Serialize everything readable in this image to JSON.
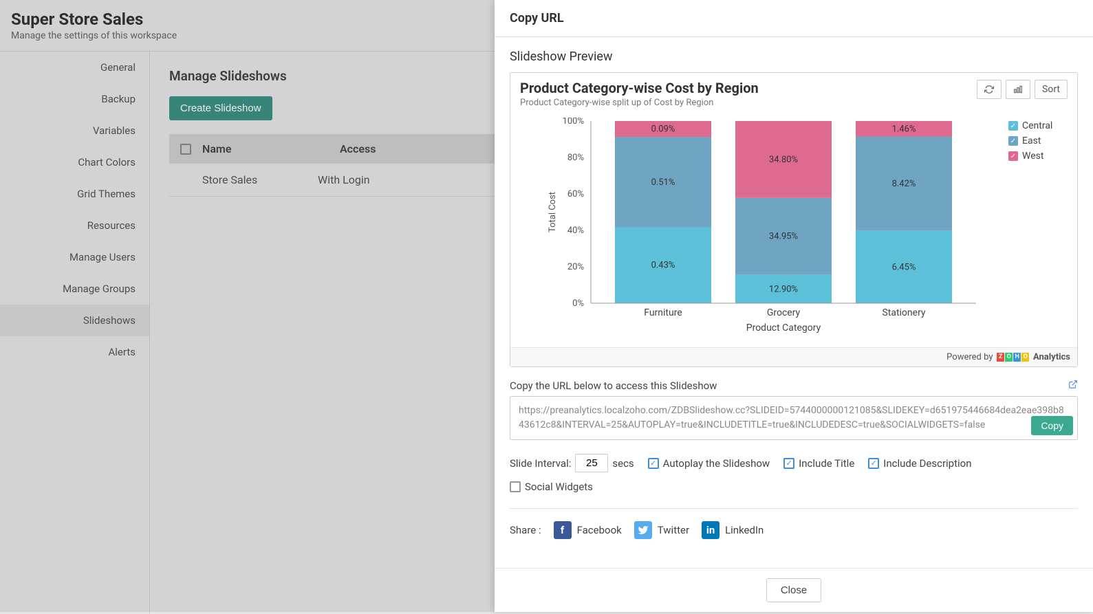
{
  "header": {
    "title": "Super Store Sales",
    "subtitle": "Manage the settings of this workspace"
  },
  "sidebar": {
    "items": [
      "General",
      "Backup",
      "Variables",
      "Chart Colors",
      "Grid Themes",
      "Resources",
      "Manage Users",
      "Manage Groups",
      "Slideshows",
      "Alerts"
    ],
    "active_index": 8
  },
  "content": {
    "title": "Manage Slideshows",
    "create_btn": "Create Slideshow",
    "columns": {
      "name": "Name",
      "access": "Access"
    },
    "rows": [
      {
        "name": "Store Sales",
        "access": "With Login"
      }
    ]
  },
  "modal": {
    "title": "Copy URL",
    "preview_label": "Slideshow Preview",
    "chart": {
      "title": "Product Category-wise Cost by Region",
      "subtitle": "Product Category-wise split up of Cost by Region",
      "sort_btn": "Sort",
      "powered_by": "Powered by",
      "analytics": "Analytics"
    },
    "url_label": "Copy the URL below to access this Slideshow",
    "url_value": "https://preanalytics.localzoho.com/ZDBSlideshow.cc?SLIDEID=5744000000121085&SLIDEKEY=d651975446684dea2eae398b843612c8&INTERVAL=25&AUTOPLAY=true&INCLUDETITLE=true&INCLUDEDESC=true&SOCIALWIDGETS=false",
    "copy_btn": "Copy",
    "options": {
      "interval_label": "Slide Interval:",
      "interval_value": "25",
      "secs": "secs",
      "autoplay": "Autoplay the Slideshow",
      "include_title": "Include Title",
      "include_desc": "Include Description",
      "social": "Social Widgets"
    },
    "share": {
      "label": "Share :",
      "facebook": "Facebook",
      "twitter": "Twitter",
      "linkedin": "LinkedIn"
    },
    "close_btn": "Close"
  },
  "chart_data": {
    "type": "bar",
    "stacked": "100%",
    "title": "Product Category-wise Cost by Region",
    "subtitle": "Product Category-wise split up of Cost by Region",
    "xlabel": "Product Category",
    "ylabel": "Total Cost",
    "categories": [
      "Furniture",
      "Grocery",
      "Stationery"
    ],
    "y_ticks": [
      "0%",
      "20%",
      "40%",
      "60%",
      "80%",
      "100%"
    ],
    "series": [
      {
        "name": "Central",
        "color": "#5cc0d8",
        "values": [
          0.43,
          12.9,
          6.45
        ],
        "labels": [
          "0.43%",
          "12.90%",
          "6.45%"
        ],
        "heights": [
          41.7,
          15.6,
          39.7
        ]
      },
      {
        "name": "East",
        "color": "#6fa5c3",
        "values": [
          0.51,
          34.95,
          8.42
        ],
        "labels": [
          "0.51%",
          "34.95%",
          "8.42%"
        ],
        "heights": [
          49.6,
          42.2,
          51.8
        ]
      },
      {
        "name": "West",
        "color": "#df6a8f",
        "values": [
          0.09,
          34.8,
          1.46
        ],
        "labels": [
          "0.09%",
          "34.80%",
          "1.46%"
        ],
        "heights": [
          8.7,
          42.2,
          8.5
        ]
      }
    ],
    "legend": [
      {
        "name": "Central",
        "color": "#5cc0d8"
      },
      {
        "name": "East",
        "color": "#6fa5c3"
      },
      {
        "name": "West",
        "color": "#df6a8f"
      }
    ]
  }
}
